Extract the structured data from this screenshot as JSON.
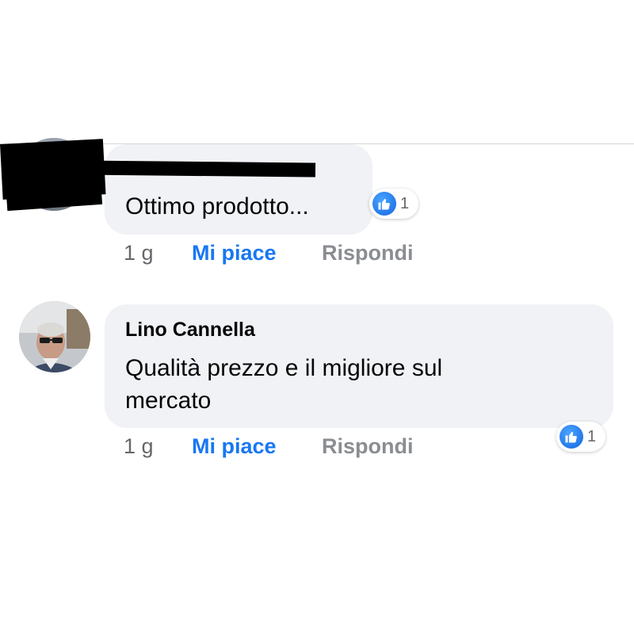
{
  "comments": [
    {
      "author": "",
      "author_redacted": true,
      "text": "Ottimo prodotto...",
      "reaction_count": "1",
      "time": "1 g",
      "like_label": "Mi piace",
      "reply_label": "Rispondi"
    },
    {
      "author": "Lino Cannella",
      "author_redacted": false,
      "text_line1": "Qualità prezzo e il migliore sul",
      "text_line2": "mercato",
      "reaction_count": "1",
      "time": "1 g",
      "like_label": "Mi piace",
      "reply_label": "Rispondi"
    }
  ],
  "colors": {
    "bubble": "#f0f2f5",
    "like_blue": "#1877f2",
    "meta_gray": "#65676b"
  },
  "icons": {
    "reaction": "like-thumbs-up-icon"
  }
}
